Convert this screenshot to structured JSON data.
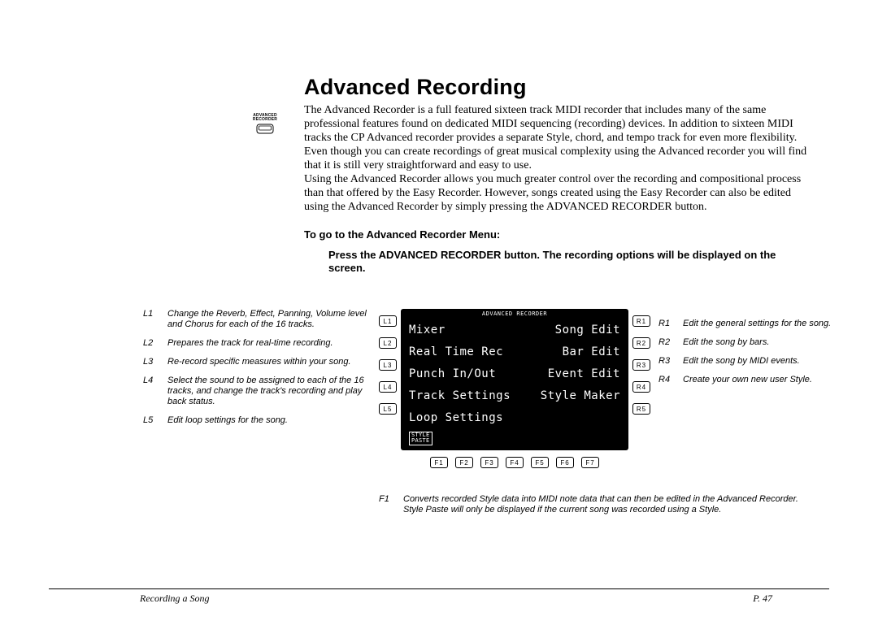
{
  "title": "Advanced Recording",
  "icon_label_top": "ADVANCED",
  "icon_label_bot": "RECORDER",
  "intro": {
    "p1": "The Advanced Recorder is a full featured sixteen track MIDI recorder that includes many of the same professional features found on dedicated MIDI sequencing (recording) devices.  In addition to sixteen MIDI tracks the CP Advanced recorder provides a separate Style, chord, and tempo track for even more flexibility.",
    "p2": "Even though you can create recordings of great musical complexity using the Advanced recorder you will  find that it is still very straightforward and easy to use.",
    "p3": "Using the Advanced Recorder allows you much greater control over the recording and compositional process than that offered by the Easy Recorder.  However, songs created using the Easy Recorder can also be edited  using the Advanced Recorder by simply pressing the ADVANCED RECORDER button."
  },
  "subhead": "To go to the Advanced Recorder Menu:",
  "instruction": "Press the ADVANCED RECORDER button.  The recording options will be displayed on the screen.",
  "L": [
    {
      "k": "L1",
      "d": "Change the Reverb, Effect, Panning, Volume level and Chorus for each of the 16 tracks."
    },
    {
      "k": "L2",
      "d": "Prepares the track for real-time recording."
    },
    {
      "k": "L3",
      "d": "Re-record specific measures within your song."
    },
    {
      "k": "L4",
      "d": "Select the sound to be assigned to each of the 16 tracks, and change the track's recording and play back status."
    },
    {
      "k": "L5",
      "d": "Edit loop settings for the song."
    }
  ],
  "R": [
    {
      "k": "R1",
      "d": "Edit  the general settings for the song."
    },
    {
      "k": "R2",
      "d": "Edit the song by bars."
    },
    {
      "k": "R3",
      "d": "Edit the song by MIDI events."
    },
    {
      "k": "R4",
      "d": "Create your own new user Style."
    }
  ],
  "F1": {
    "k": "F1",
    "d": "Converts recorded Style data into MIDI note data that can then be edited in the Advanced Recorder.  Style Paste will only be displayed if the current song was recorded using a Style."
  },
  "lcd": {
    "title": "ADVANCED RECORDER",
    "rows": [
      {
        "l": "Mixer",
        "r": "Song Edit"
      },
      {
        "l": "Real Time Rec",
        "r": "Bar Edit"
      },
      {
        "l": "Punch In/Out",
        "r": "Event Edit"
      },
      {
        "l": "Track Settings",
        "r": "Style Maker"
      },
      {
        "l": "Loop Settings",
        "r": ""
      }
    ],
    "foot1": "STYLE",
    "foot2": "PASTE",
    "Lbtn": [
      "L1",
      "L2",
      "L3",
      "L4",
      "L5"
    ],
    "Rbtn": [
      "R1",
      "R2",
      "R3",
      "R4",
      "R5"
    ],
    "Fbtn": [
      "F1",
      "F2",
      "F3",
      "F4",
      "F5",
      "F6",
      "F7"
    ]
  },
  "footer": {
    "left": "Recording a Song",
    "right": "P. 47"
  }
}
